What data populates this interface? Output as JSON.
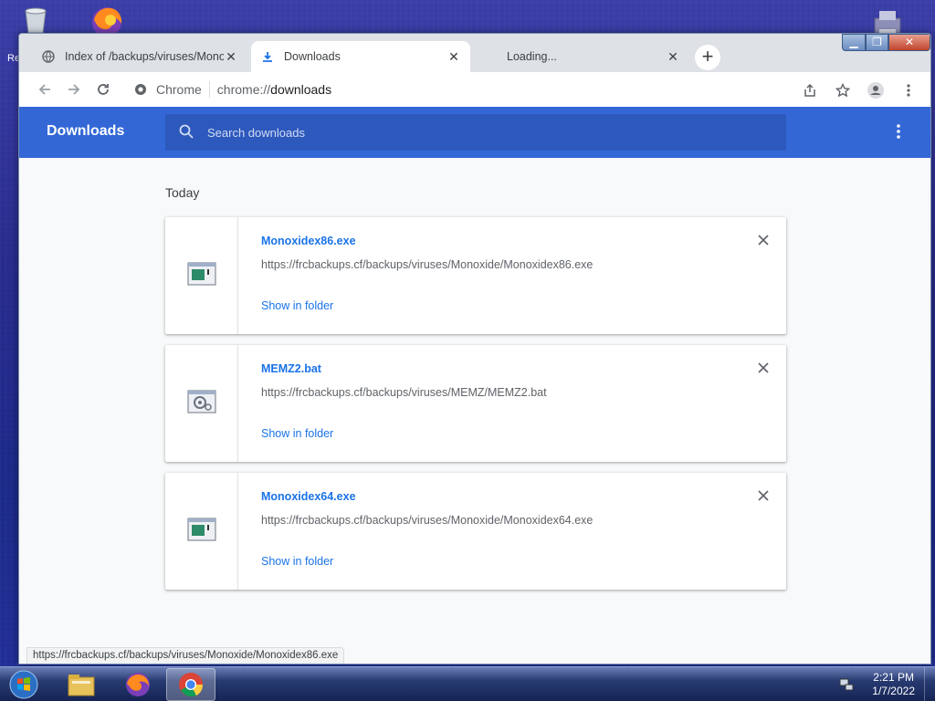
{
  "desktop": {
    "recycle_label": "Re"
  },
  "browser": {
    "tabs": [
      {
        "title": "Index of /backups/viruses/Monoxide",
        "active": false
      },
      {
        "title": "Downloads",
        "active": true
      },
      {
        "title": "Loading...",
        "active": false
      }
    ],
    "new_tab_label": "+",
    "omnibox": {
      "site_label": "Chrome",
      "url_scheme": "chrome://",
      "url_path": "downloads"
    },
    "status_bubble": "https://frcbackups.cf/backups/viruses/Monoxide/Monoxidex86.exe"
  },
  "downloads_page": {
    "title": "Downloads",
    "search_placeholder": "Search downloads",
    "section_label": "Today",
    "items": [
      {
        "name": "Monoxidex86.exe",
        "url": "https://frcbackups.cf/backups/viruses/Monoxide/Monoxidex86.exe",
        "action": "Show in folder",
        "icon": "exe-file-icon"
      },
      {
        "name": "MEMZ2.bat",
        "url": "https://frcbackups.cf/backups/viruses/MEMZ/MEMZ2.bat",
        "action": "Show in folder",
        "icon": "batch-file-icon"
      },
      {
        "name": "Monoxidex64.exe",
        "url": "https://frcbackups.cf/backups/viruses/Monoxide/Monoxidex64.exe",
        "action": "Show in folder",
        "icon": "exe-file-icon"
      }
    ]
  },
  "taskbar": {
    "time": "2:21 PM",
    "date": "1/7/2022",
    "pinned": [
      "file-explorer-icon",
      "firefox-icon",
      "chrome-icon"
    ]
  },
  "colors": {
    "accent": "#3367d6",
    "link": "#1a73e8"
  }
}
